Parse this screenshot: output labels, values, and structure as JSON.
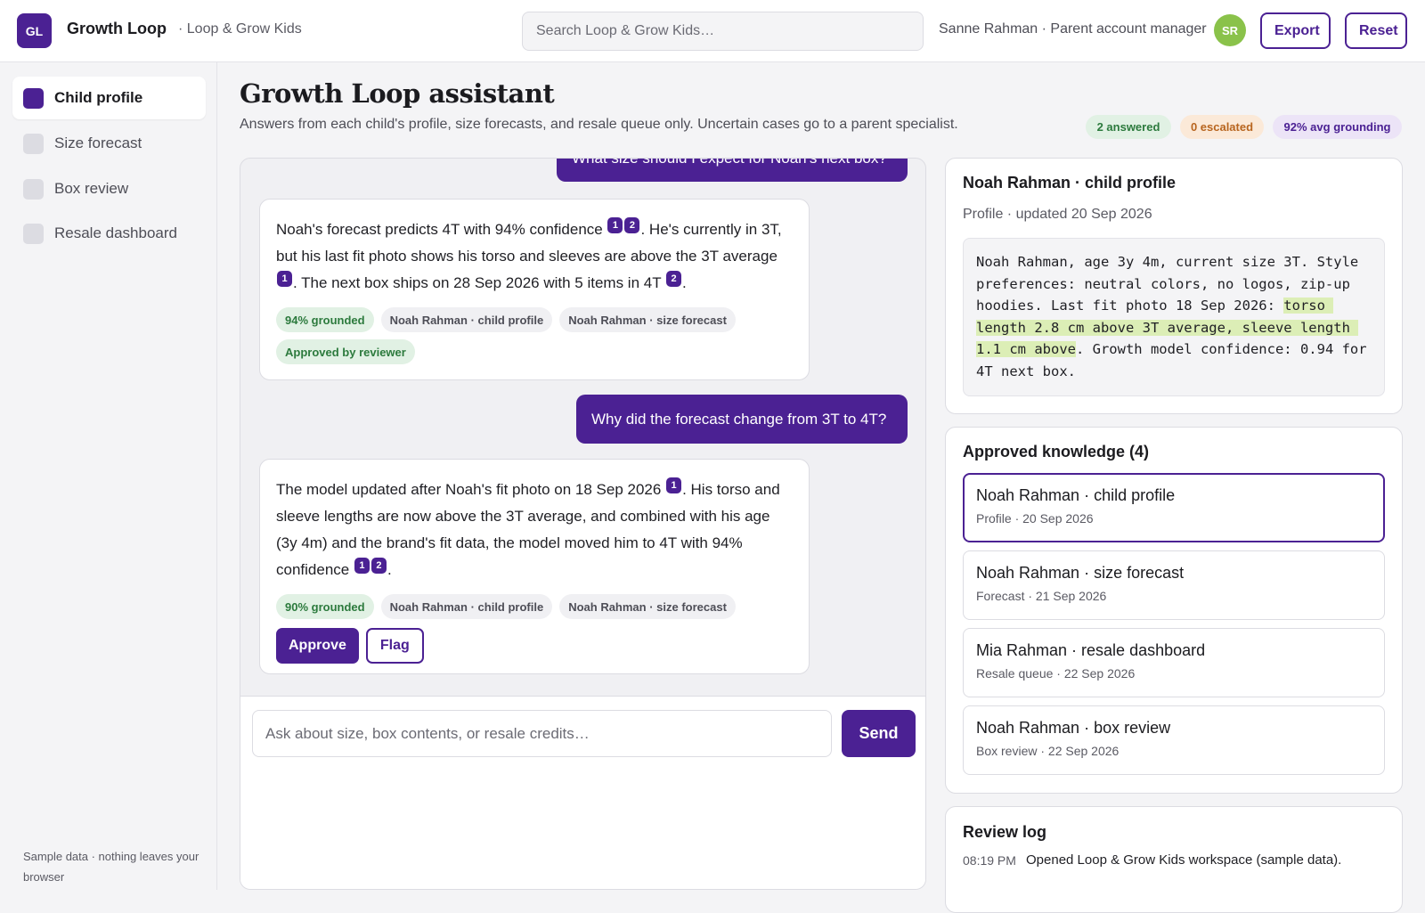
{
  "header": {
    "logo_text": "GL",
    "app_name": "Growth Loop",
    "workspace": "· Loop & Grow Kids",
    "search_placeholder": "Search Loop & Grow Kids…",
    "user_label": "Sanne Rahman · Parent account manager",
    "avatar_initials": "SR",
    "export_label": "Export",
    "reset_label": "Reset"
  },
  "sidebar": {
    "items": [
      {
        "label": "Child profile",
        "active": true
      },
      {
        "label": "Size forecast",
        "active": false
      },
      {
        "label": "Box review",
        "active": false
      },
      {
        "label": "Resale dashboard",
        "active": false
      }
    ],
    "footer": "Sample data · nothing leaves your browser"
  },
  "main": {
    "title": "Growth Loop assistant",
    "subtitle": "Answers from each child's profile, size forecasts, and resale queue only. Uncertain cases go to a parent specialist.",
    "stats": {
      "answered": "2 answered",
      "escalated": "0 escalated",
      "grounding": "92% avg grounding"
    }
  },
  "chat": {
    "messages": [
      {
        "role": "user",
        "text": "What size should I expect for Noah's next box?"
      },
      {
        "role": "assistant",
        "segments": [
          {
            "t": "Noah's forecast predicts 4T with 94% confidence "
          },
          {
            "c": "1"
          },
          {
            "c": "2"
          },
          {
            "t": ". He's currently in 3T, but his last fit photo shows his torso and sleeves are above the 3T average "
          },
          {
            "c": "1"
          },
          {
            "t": ". The next box ships on 28 Sep 2026 with 5 items in 4T "
          },
          {
            "c": "2"
          },
          {
            "t": "."
          }
        ],
        "grounded": "94% grounded",
        "sources": [
          "Noah Rahman · child profile",
          "Noah Rahman · size forecast"
        ],
        "status": "Approved by reviewer"
      },
      {
        "role": "user",
        "text": "Why did the forecast change from 3T to 4T?"
      },
      {
        "role": "assistant",
        "segments": [
          {
            "t": "The model updated after Noah's fit photo on 18 Sep 2026 "
          },
          {
            "c": "1"
          },
          {
            "t": ". His torso and sleeve lengths are now above the 3T average, and combined with his age (3y 4m) and the brand's fit data, the model moved him to 4T with 94% confidence "
          },
          {
            "c": "1"
          },
          {
            "c": "2"
          },
          {
            "t": "."
          }
        ],
        "grounded": "90% grounded",
        "sources": [
          "Noah Rahman · child profile",
          "Noah Rahman · size forecast"
        ],
        "approve_label": "Approve",
        "flag_label": "Flag"
      }
    ],
    "composer_placeholder": "Ask about size, box contents, or resale credits…",
    "send_label": "Send"
  },
  "profile": {
    "title": "Noah Rahman · child profile",
    "meta": "Profile · updated 20 Sep 2026",
    "text_before": "Noah Rahman, age 3y 4m, current size 3T. Style preferences: neutral colors, no logos, zip-up hoodies. Last fit photo 18 Sep 2026: ",
    "text_highlight": "torso length 2.8 cm above 3T average, sleeve length 1.1 cm above",
    "text_after": ". Growth model confidence: 0.94 for 4T next box."
  },
  "knowledge": {
    "title": "Approved knowledge (4)",
    "items": [
      {
        "title": "Noah Rahman · child profile",
        "sub": "Profile · 20 Sep 2026"
      },
      {
        "title": "Noah Rahman · size forecast",
        "sub": "Forecast · 21 Sep 2026"
      },
      {
        "title": "Mia Rahman · resale dashboard",
        "sub": "Resale queue · 22 Sep 2026"
      },
      {
        "title": "Noah Rahman · box review",
        "sub": "Box review · 22 Sep 2026"
      }
    ]
  },
  "review_log": {
    "title": "Review log",
    "entries": [
      {
        "time": "08:19 PM",
        "text": "Opened Loop & Grow Kids workspace (sample data)."
      }
    ]
  },
  "colors": {
    "accent": "#4b2193",
    "grounded_bg": "#e1f1e4",
    "escalated_bg": "#fbe9d8",
    "highlight": "#dceeb6",
    "avatar": "#8ac24a"
  }
}
